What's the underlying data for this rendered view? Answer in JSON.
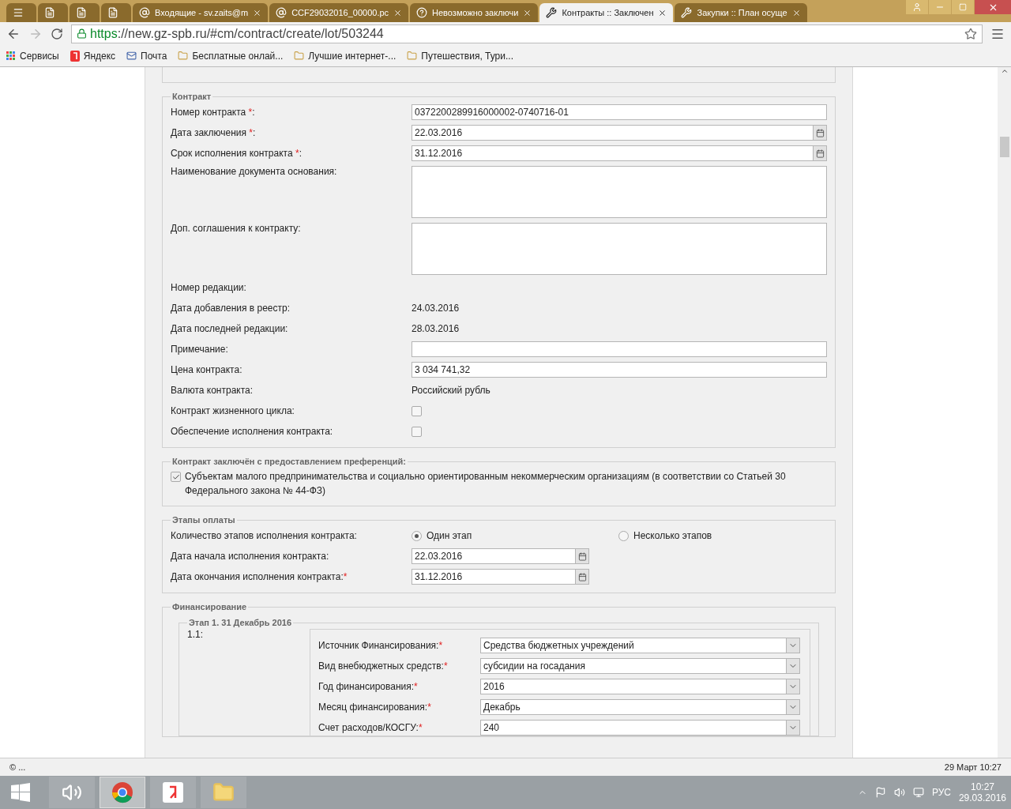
{
  "browser": {
    "tabs": [
      {
        "kind": "app",
        "selected": false
      },
      {
        "kind": "doc",
        "selected": false
      },
      {
        "kind": "doc",
        "selected": false
      },
      {
        "kind": "doc",
        "selected": false
      },
      {
        "kind": "mail",
        "label": "Входящие - sv.zaits@m",
        "selected": false
      },
      {
        "kind": "mail",
        "label": "CCF29032016_00000.pc",
        "selected": false
      },
      {
        "kind": "help",
        "label": "Невозможно заключи",
        "selected": false
      },
      {
        "kind": "tool",
        "label": "Контракты :: Заключен",
        "selected": true
      },
      {
        "kind": "tool",
        "label": "Закупки :: План осуще",
        "selected": false
      }
    ],
    "address": {
      "scheme": "https",
      "rest": "://new.gz-spb.ru/#cm/contract/create/lot/503244"
    },
    "bookmarks": [
      {
        "kind": "apps",
        "label": "Сервисы"
      },
      {
        "kind": "yandex",
        "label": "Яндекс"
      },
      {
        "kind": "mail",
        "label": "Почта"
      },
      {
        "kind": "folder",
        "label": "Бесплатные онлай..."
      },
      {
        "kind": "folder",
        "label": "Лучшие интернет-..."
      },
      {
        "kind": "folder",
        "label": "Путешествия, Тури..."
      }
    ]
  },
  "contract": {
    "legend": "Контракт",
    "rows": [
      {
        "kind": "text",
        "label": "Номер контракта ",
        "star": "*",
        "suffix": ":",
        "value": "0372200289916000002-0740716-01"
      },
      {
        "kind": "date",
        "label": "Дата заключения ",
        "star": "*",
        "suffix": ":",
        "value": "22.03.2016"
      },
      {
        "kind": "date",
        "label": "Срок исполнения контракта ",
        "star": "*",
        "suffix": ":",
        "value": "31.12.2016"
      },
      {
        "kind": "textarea",
        "label": "Наименование документа основания:"
      },
      {
        "kind": "textarea",
        "label": "Доп. соглашения к контракту:"
      },
      {
        "kind": "static",
        "label": "Номер редакции:"
      },
      {
        "kind": "static",
        "label": "Дата добавления в реестр:",
        "value": "24.03.2016"
      },
      {
        "kind": "static",
        "label": "Дата последней редакции:",
        "value": "28.03.2016"
      },
      {
        "kind": "text",
        "label": "Примечание:"
      },
      {
        "kind": "text",
        "label": "Цена контракта:",
        "value": "3 034 741,32"
      },
      {
        "kind": "static",
        "label": "Валюта контракта:",
        "value": "Российский рубль"
      },
      {
        "kind": "checkbox",
        "label": "Контракт жизненного цикла:",
        "checked": false
      },
      {
        "kind": "checkbox",
        "label": "Обеспечение исполнения контракта:",
        "checked": false
      }
    ]
  },
  "preferences": {
    "legend": "Контракт заключён с предоставлением преференций:",
    "checked": true,
    "text": "Субъектам малого предпринимательства и социально ориентированным некоммерческим организациям (в соответствии со Статьей 30 Федерального закона № 44-ФЗ)"
  },
  "stages": {
    "legend": "Этапы оплаты",
    "rows": [
      {
        "kind": "radio",
        "label": "Количество этапов исполнения контракта:",
        "options": [
          {
            "label": "Один этап",
            "selected": true
          },
          {
            "label": "Несколько этапов",
            "selected": false
          }
        ]
      },
      {
        "kind": "date",
        "label": "Дата начала исполнения контракта:",
        "value": "22.03.2016"
      },
      {
        "kind": "date",
        "label": "Дата окончания исполнения контракта:",
        "star": "*",
        "value": "31.12.2016"
      }
    ]
  },
  "financing": {
    "legend": "Финансирование",
    "stage": {
      "legend": "Этап 1. 31 Декабрь 2016",
      "number": "1.1:",
      "rows": [
        {
          "label": "Источник Финансирования:",
          "star": "*",
          "value": "Средства бюджетных учреждений"
        },
        {
          "label": "Вид внебюджетных средств:",
          "star": "*",
          "value": "субсидии на госадания"
        },
        {
          "label": "Год финансирования:",
          "star": "*",
          "value": "2016"
        },
        {
          "label": "Месяц финансирования:",
          "star": "*",
          "value": "Декабрь"
        },
        {
          "label": "Счет расходов/КОСГУ:",
          "star": "*",
          "value": "240"
        }
      ]
    }
  },
  "status_bar": {
    "left": "© ...",
    "right": "29 Март 10:27"
  },
  "taskbar": {
    "apps": [
      {
        "kind": "speaker",
        "selected": false
      },
      {
        "kind": "chrome",
        "selected": true
      },
      {
        "kind": "yandex",
        "selected": false
      },
      {
        "kind": "explorer",
        "selected": false
      }
    ],
    "language": "РУС",
    "time": "10:27",
    "date": "29.03.2016"
  }
}
